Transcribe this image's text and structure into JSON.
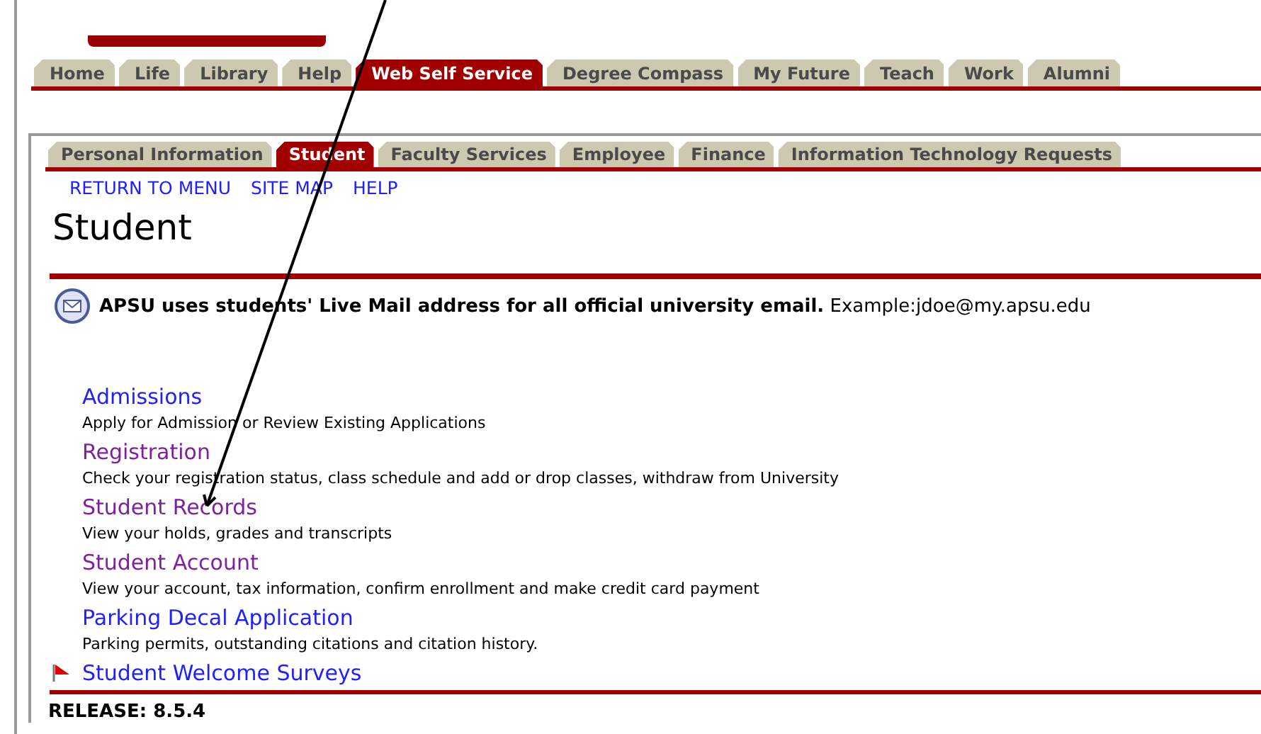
{
  "main_tabs": [
    {
      "label": "Home",
      "selected": false
    },
    {
      "label": "Life",
      "selected": false
    },
    {
      "label": "Library",
      "selected": false
    },
    {
      "label": "Help",
      "selected": false
    },
    {
      "label": "Web Self Service",
      "selected": true
    },
    {
      "label": "Degree Compass",
      "selected": false
    },
    {
      "label": "My Future",
      "selected": false
    },
    {
      "label": "Teach",
      "selected": false
    },
    {
      "label": "Work",
      "selected": false
    },
    {
      "label": "Alumni",
      "selected": false
    }
  ],
  "sub_tabs": [
    {
      "label": "Personal Information",
      "selected": false
    },
    {
      "label": "Student",
      "selected": true
    },
    {
      "label": "Faculty Services",
      "selected": false
    },
    {
      "label": "Employee",
      "selected": false
    },
    {
      "label": "Finance",
      "selected": false
    },
    {
      "label": "Information Technology Requests",
      "selected": false
    }
  ],
  "nav_links": [
    "RETURN TO MENU",
    "SITE MAP",
    "HELP"
  ],
  "page_title": "Student",
  "notice": {
    "text": "**APSU uses students' Live Mail address for all official university email.** Example:jdoe@my.apsu.edu"
  },
  "menu_items": [
    {
      "title": "Admissions",
      "description": "Apply for Admission or Review Existing Applications",
      "visited": false,
      "flagged": false
    },
    {
      "title": "Registration",
      "description": "Check your registration status, class schedule and add or drop classes, withdraw from University",
      "visited": true,
      "flagged": false
    },
    {
      "title": "Student Records",
      "description": "View your holds, grades and transcripts",
      "visited": true,
      "flagged": false
    },
    {
      "title": "Student Account",
      "description": "View your account, tax information, confirm enrollment and make credit card payment",
      "visited": true,
      "flagged": false
    },
    {
      "title": "Parking Decal Application",
      "description": "Parking permits, outstanding citations and citation history.",
      "visited": false,
      "flagged": false
    },
    {
      "title": "Student Welcome Surveys",
      "visited": false,
      "flagged": true
    }
  ],
  "release": "RELEASE: 8.5.4"
}
